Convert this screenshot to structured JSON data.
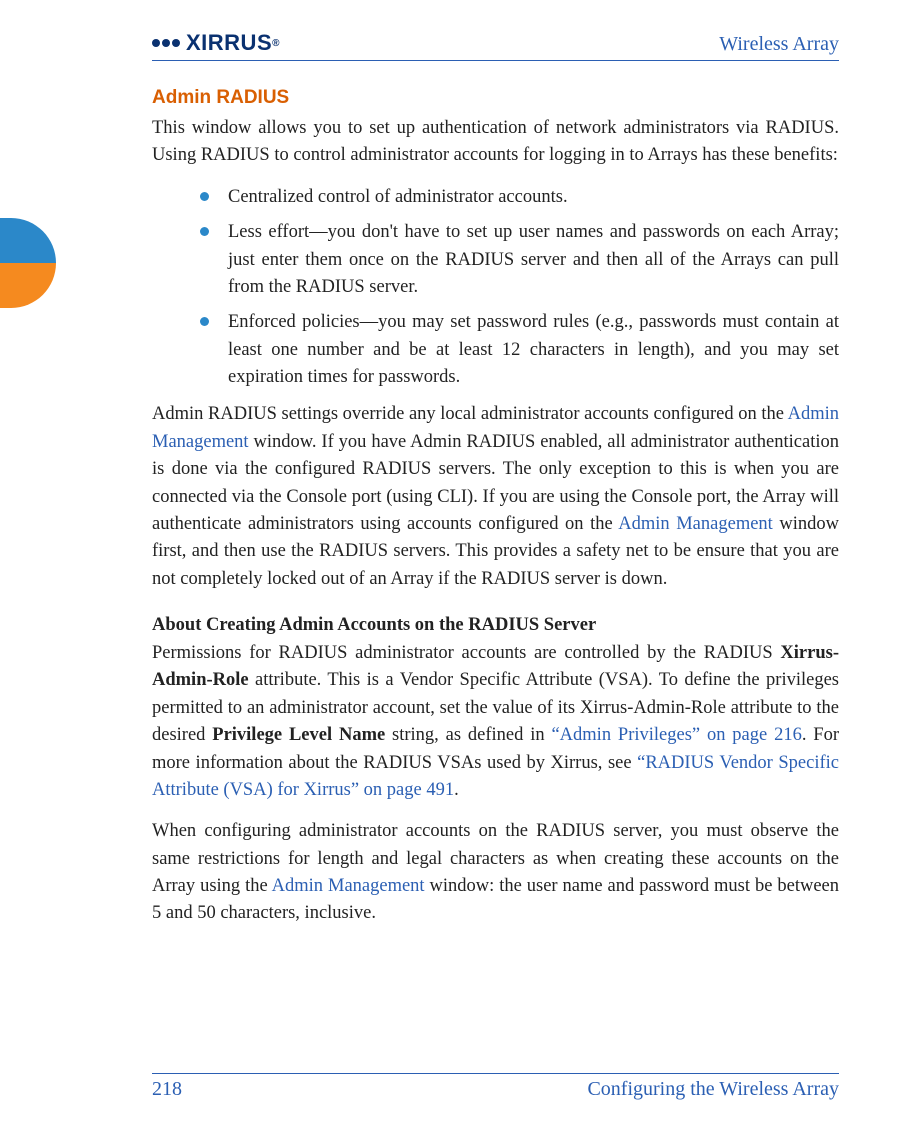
{
  "header": {
    "logo_text": "XIRRUS",
    "right": "Wireless Array"
  },
  "section": {
    "title": "Admin RADIUS",
    "intro": "This window allows you to set up authentication of network administrators via RADIUS. Using RADIUS to control administrator accounts for logging in to Arrays has these benefits:",
    "bullets": [
      "Centralized control of administrator accounts.",
      "Less effort—you don't have to set up user names and passwords on each Array; just enter them once on the RADIUS server and then all of the Arrays can pull from the RADIUS server.",
      "Enforced policies—you may set password rules (e.g., passwords must contain at least one number and be at least 12 characters in length), and you may set expiration times for passwords."
    ],
    "para2_pre": "Admin RADIUS settings override any local administrator accounts configured on the ",
    "para2_link1": "Admin Management",
    "para2_mid": " window. If you have Admin RADIUS enabled, all administrator authentication is done via the configured RADIUS servers. The only exception to this is when you are connected via the Console port (using CLI). If you are using the Console port, the Array will authenticate administrators using accounts configured on the ",
    "para2_link2": "Admin Management",
    "para2_post": " window first, and then use the RADIUS servers. This provides a safety net to be ensure that you are not completely locked out of an Array if the RADIUS server is down."
  },
  "subsection": {
    "heading": "About Creating Admin Accounts on the RADIUS Server",
    "p1_a": "Permissions for RADIUS administrator accounts are controlled by the RADIUS ",
    "p1_bold1": "Xirrus-Admin-Role",
    "p1_b": " attribute. This is a Vendor Specific Attribute (VSA). To define the privileges permitted to an administrator account, set the value of its Xirrus-Admin-Role attribute to the desired ",
    "p1_bold2": "Privilege Level Name",
    "p1_c": " string, as defined in ",
    "p1_link1": "“Admin Privileges” on page 216",
    "p1_d": ". For more information about the RADIUS VSAs used by Xirrus, see ",
    "p1_link2": "“RADIUS Vendor Specific Attribute (VSA) for Xirrus” on page 491",
    "p1_e": ".",
    "p2_a": "When configuring administrator accounts on the RADIUS server, you must observe the same restrictions for length and legal characters as when creating these accounts on the Array using the ",
    "p2_link": "Admin Management",
    "p2_b": " window: the user name and password must be between 5 and 50 characters, inclusive."
  },
  "footer": {
    "page": "218",
    "label": "Configuring the Wireless Array"
  }
}
